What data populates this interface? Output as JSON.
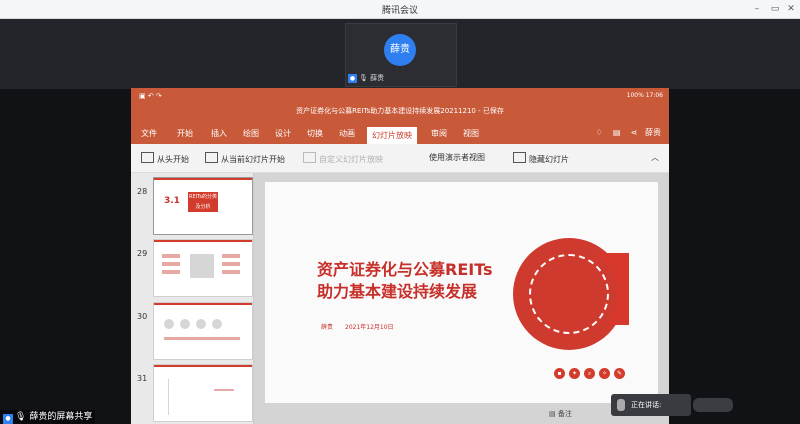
{
  "window": {
    "title": "腾讯会议",
    "controls": [
      "–",
      "▭",
      "✕"
    ]
  },
  "participant": {
    "avatar_text": "薛贵",
    "name": "薛贵"
  },
  "ppt": {
    "doc_title": "资产证券化与公募REITs助力基本建设持续发展20211210 - 已保存",
    "status": "100%  17:06",
    "user": "薛贵",
    "tabs": [
      "文件",
      "开始",
      "插入",
      "绘图",
      "设计",
      "切换",
      "动画",
      "幻灯片放映",
      "审阅",
      "视图"
    ],
    "active_tab": "幻灯片放映",
    "ribbon": {
      "from_start": "从头开始",
      "from_current": "从当前幻灯片开始",
      "custom": "自定义幻灯片放映",
      "presenter_view": "使用演示者视图",
      "hide_slide": "隐藏幻灯片"
    },
    "thumbnails": [
      {
        "number": "28",
        "label": "3.1",
        "box_text": "REITs的分类及分析"
      },
      {
        "number": "29",
        "label": ""
      },
      {
        "number": "30",
        "label": ""
      },
      {
        "number": "31",
        "label": ""
      }
    ],
    "slide": {
      "title_line1": "资产证券化与公募REITs",
      "title_line2": "助力基本建设持续发展",
      "author": "薛贵",
      "date": "2021年12月10日"
    },
    "notes_label": "备注"
  },
  "speaking": {
    "label": "正在讲话:"
  },
  "share_label": "薛贵的屏幕共享"
}
